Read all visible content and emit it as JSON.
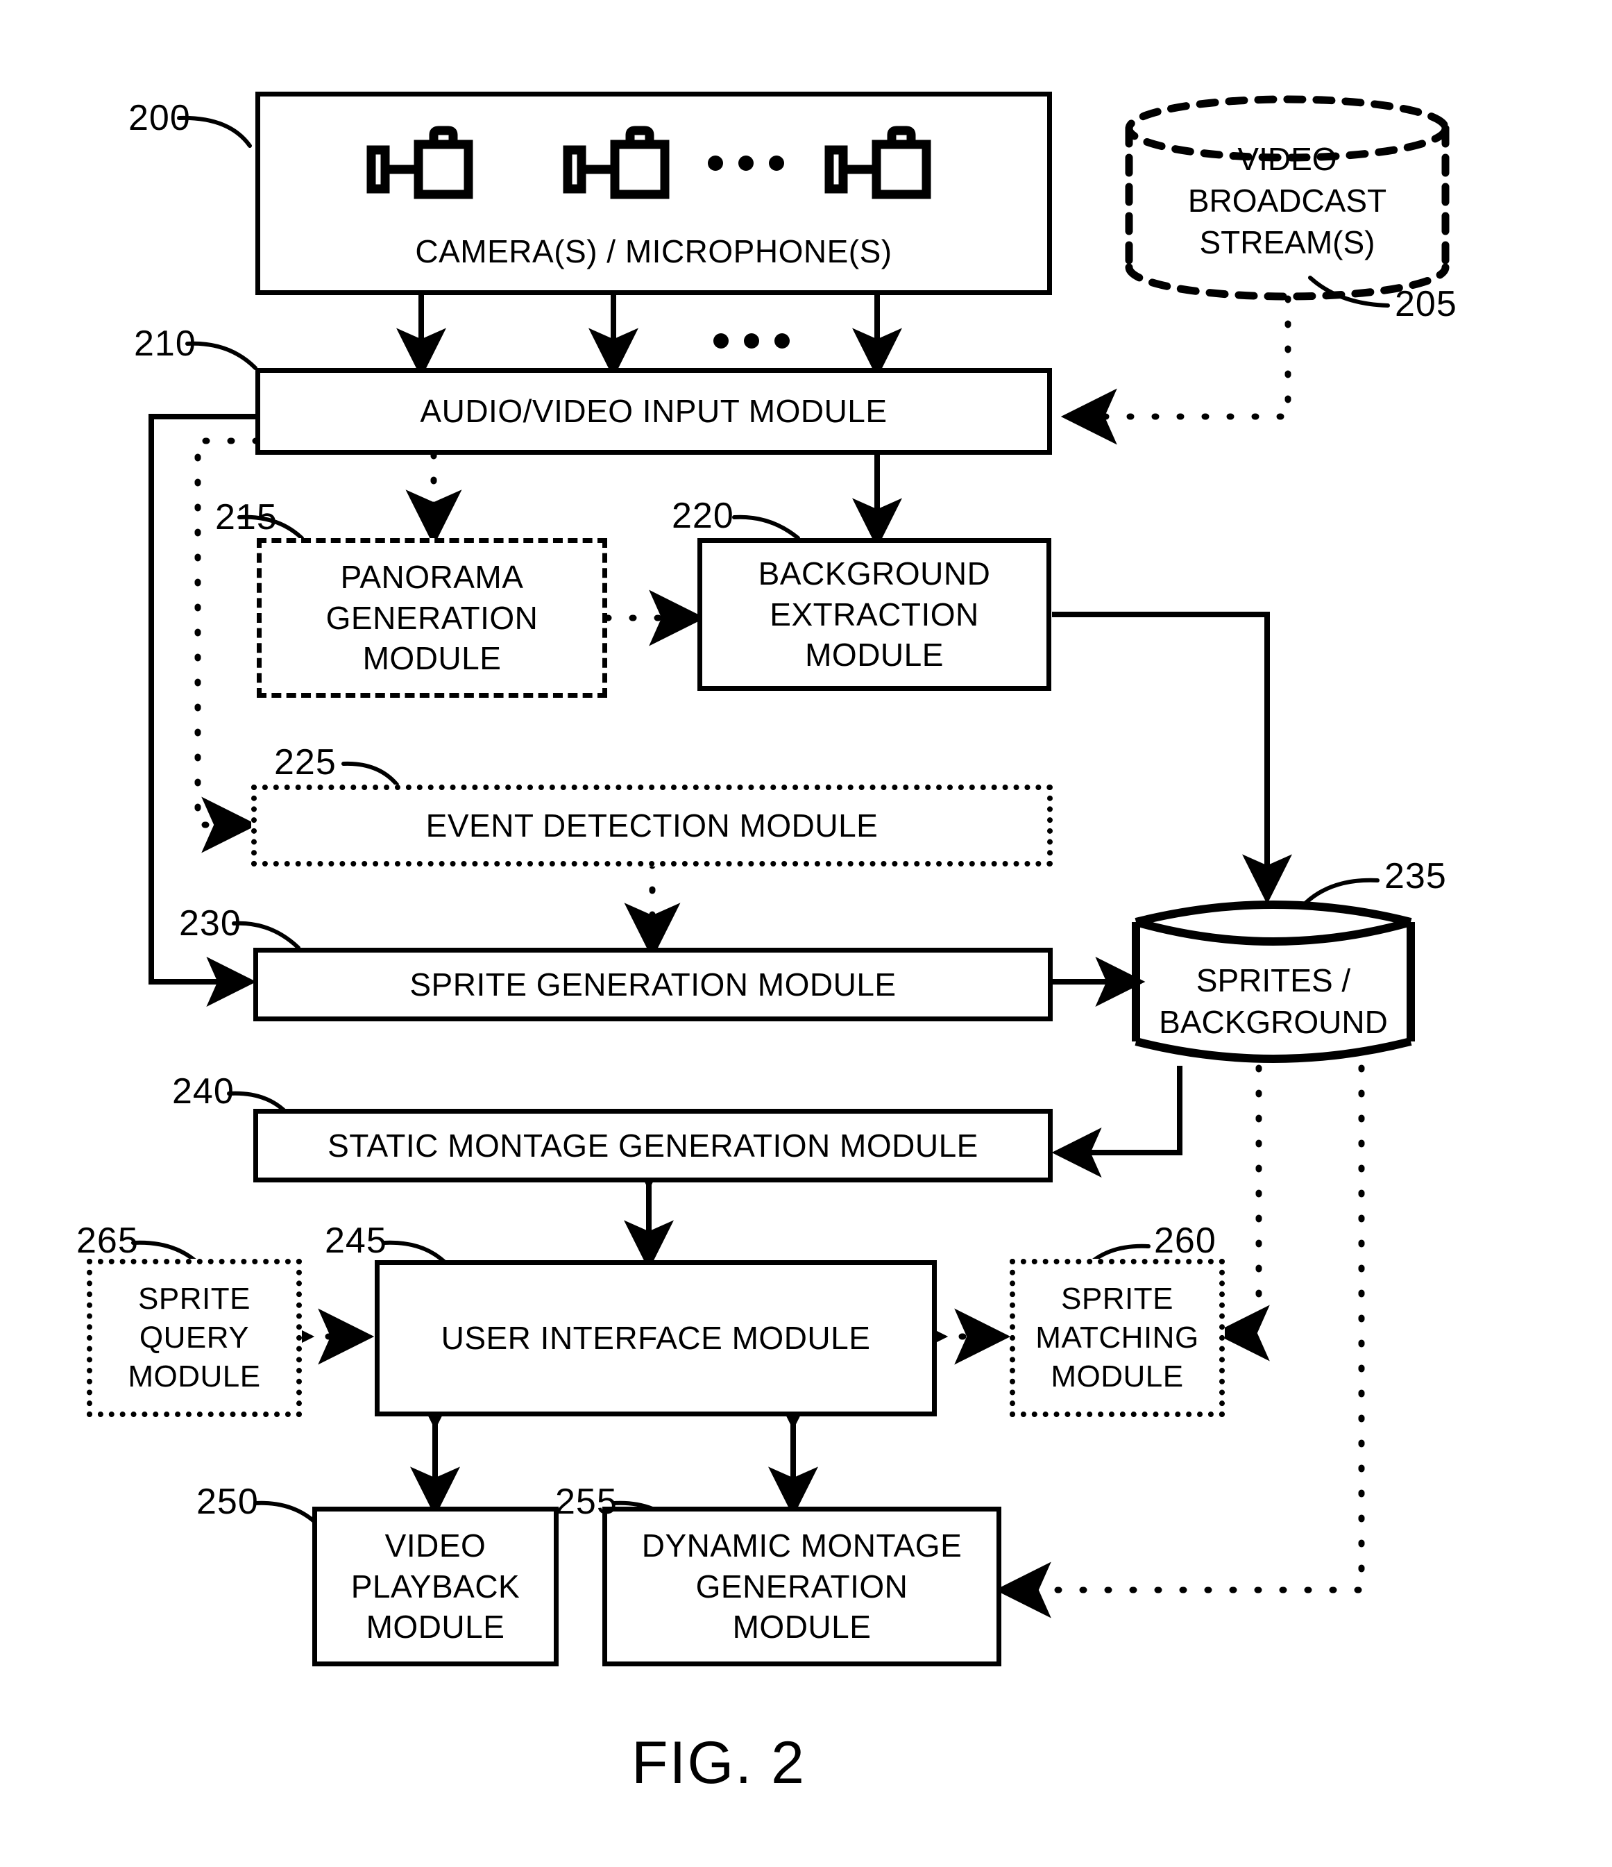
{
  "figure": {
    "caption": "FIG. 2",
    "ellipsis": "• • •"
  },
  "nodes": {
    "cameras": {
      "ref": "200",
      "label": "CAMERA(S) / MICROPHONE(S)",
      "style": "solid-box",
      "icons": [
        "camera-icon",
        "camera-icon",
        "camera-icon"
      ]
    },
    "video_broadcast": {
      "ref": "205",
      "label_lines": [
        "VIDEO",
        "BROADCAST",
        "STREAM(S)"
      ],
      "style": "dashed-cylinder"
    },
    "av_input": {
      "ref": "210",
      "label": "AUDIO/VIDEO INPUT MODULE",
      "style": "solid-box"
    },
    "panorama": {
      "ref": "215",
      "label_lines": [
        "PANORAMA",
        "GENERATION",
        "MODULE"
      ],
      "style": "dashed-box"
    },
    "background_extraction": {
      "ref": "220",
      "label_lines": [
        "BACKGROUND",
        "EXTRACTION",
        "MODULE"
      ],
      "style": "solid-box"
    },
    "event_detection": {
      "ref": "225",
      "label": "EVENT DETECTION MODULE",
      "style": "dashed-box"
    },
    "sprite_generation": {
      "ref": "230",
      "label": "SPRITE GENERATION MODULE",
      "style": "solid-box"
    },
    "sprites_background": {
      "ref": "235",
      "label_lines": [
        "SPRITES /",
        "BACKGROUND"
      ],
      "style": "solid-cylinder"
    },
    "static_montage": {
      "ref": "240",
      "label": "STATIC MONTAGE GENERATION MODULE",
      "style": "solid-box"
    },
    "user_interface": {
      "ref": "245",
      "label": "USER INTERFACE MODULE",
      "style": "solid-box"
    },
    "video_playback": {
      "ref": "250",
      "label_lines": [
        "VIDEO",
        "PLAYBACK",
        "MODULE"
      ],
      "style": "solid-box"
    },
    "dynamic_montage": {
      "ref": "255",
      "label_lines": [
        "DYNAMIC MONTAGE",
        "GENERATION",
        "MODULE"
      ],
      "style": "solid-box"
    },
    "sprite_matching": {
      "ref": "260",
      "label_lines": [
        "SPRITE",
        "MATCHING",
        "MODULE"
      ],
      "style": "dashed-box"
    },
    "sprite_query": {
      "ref": "265",
      "label_lines": [
        "SPRITE",
        "QUERY",
        "MODULE"
      ],
      "style": "dashed-box"
    }
  },
  "colors": {
    "line": "#000000",
    "background": "#ffffff"
  }
}
